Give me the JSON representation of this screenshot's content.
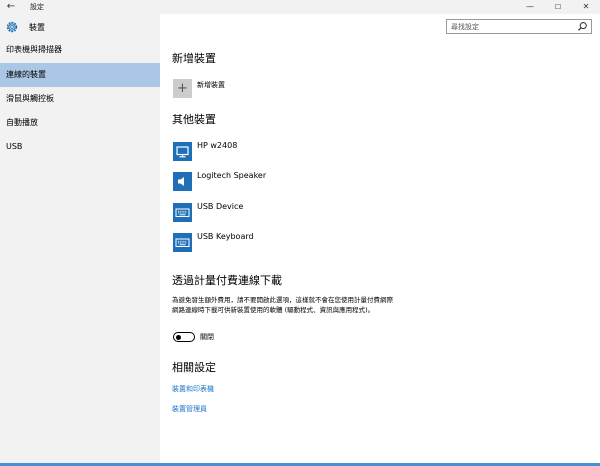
{
  "window": {
    "title": "設定",
    "back_glyph": "←",
    "minimize_glyph": "—",
    "maximize_glyph": "☐",
    "close_glyph": "✕"
  },
  "header": {
    "title": "裝置"
  },
  "search": {
    "placeholder": "尋找設定"
  },
  "sidebar": {
    "items": [
      {
        "label": "印表機與掃描器",
        "active": false
      },
      {
        "label": "連線的裝置",
        "active": true
      },
      {
        "label": "滑鼠與觸控板",
        "active": false
      },
      {
        "label": "自動播放",
        "active": false
      },
      {
        "label": "USB",
        "active": false
      }
    ]
  },
  "add_section": {
    "heading": "新增裝置",
    "plus_glyph": "+",
    "button_label": "新增裝置"
  },
  "other_section": {
    "heading": "其他裝置",
    "devices": [
      {
        "name": "HP w2408",
        "icon": "monitor-icon"
      },
      {
        "name": "Logitech Speaker",
        "icon": "speaker-icon"
      },
      {
        "name": "USB Device",
        "icon": "keyboard-icon"
      },
      {
        "name": "USB Keyboard",
        "icon": "keyboard-icon"
      }
    ]
  },
  "metered_section": {
    "heading": "透過計量付費連線下載",
    "description": "為避免發生額外費用，請不要開啟此選項，這樣就不會在您使用計量付費網際網路連線時下載可供新裝置使用的軟體 (驅動程式、資訊與應用程式)。",
    "toggle_label": "關閉",
    "toggle_on": false
  },
  "related_section": {
    "heading": "相關設定",
    "links": [
      "裝置和印表機",
      "裝置管理員"
    ]
  },
  "colors": {
    "accent": "#1e6fb8",
    "link": "#1a73c8",
    "selection": "#aac8e5"
  }
}
